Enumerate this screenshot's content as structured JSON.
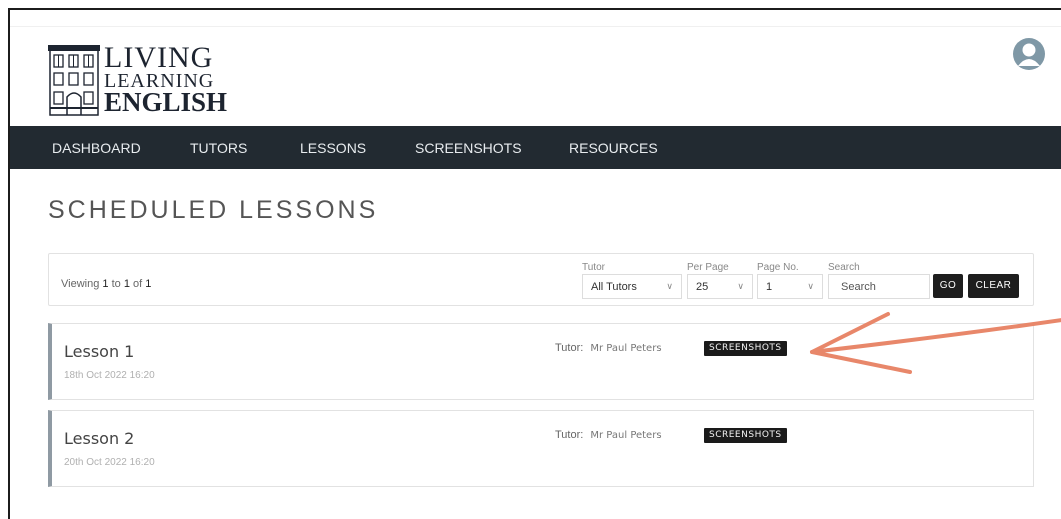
{
  "brand": {
    "line1": "LIVING",
    "line2": "LEARNING",
    "line3": "ENGLISH"
  },
  "nav": {
    "items": [
      "DASHBOARD",
      "TUTORS",
      "LESSONS",
      "SCREENSHOTS",
      "RESOURCES"
    ]
  },
  "page": {
    "title": "SCHEDULED LESSONS"
  },
  "filters": {
    "viewing_prefix": "Viewing",
    "viewing_from": "1",
    "viewing_to_word": "to",
    "viewing_to": "1",
    "viewing_of_word": "of",
    "viewing_total": "1",
    "tutor_label": "Tutor",
    "tutor_value": "All Tutors",
    "per_page_label": "Per Page",
    "per_page_value": "25",
    "page_no_label": "Page No.",
    "page_no_value": "1",
    "search_label": "Search",
    "search_placeholder": "Search",
    "go_label": "GO",
    "clear_label": "CLEAR"
  },
  "lessons": [
    {
      "title": "Lesson 1",
      "date": "18th Oct 2022 16:20",
      "tutor_label": "Tutor:",
      "tutor_name": "Mr Paul Peters",
      "button": "SCREENSHOTS"
    },
    {
      "title": "Lesson 2",
      "date": "20th Oct 2022 16:20",
      "tutor_label": "Tutor:",
      "tutor_name": "Mr Paul Peters",
      "button": "SCREENSHOTS"
    }
  ],
  "colors": {
    "nav_bg": "#222a31",
    "button_bg": "#1e1e1e",
    "card_accent": "#8f9aa3",
    "annotation_arrow": "#e8876a",
    "avatar": "#7f98a6"
  }
}
